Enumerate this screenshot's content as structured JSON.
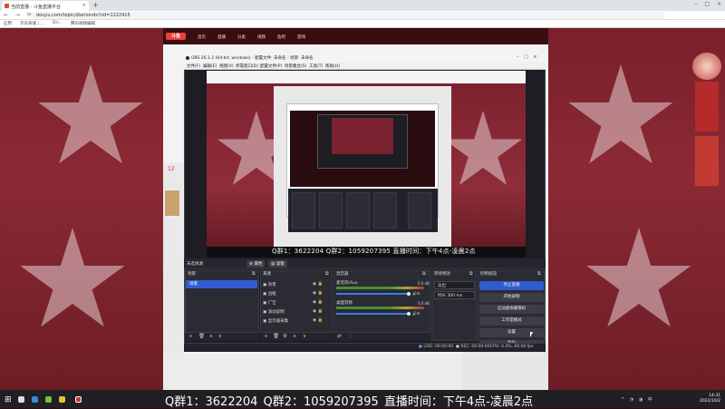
{
  "browser": {
    "tab_title": "当前直播 - 斗鱼直播平台",
    "new_tab": "+",
    "window_controls": [
      "–",
      "□",
      "×"
    ],
    "nav_icons": [
      "←",
      "→",
      "⟳"
    ],
    "url": "douyu.com/topic/diamonds?rid=1222415",
    "bookmarks": [
      "应用",
      "京东商城 | ...",
      "Dri...",
      "腾讯视频编辑"
    ]
  },
  "site": {
    "logo": "斗鱼",
    "nav": [
      "首页",
      "直播",
      "分类",
      "视频",
      "鱼吧",
      "游戏"
    ],
    "side_count": "12"
  },
  "obs": {
    "title": "OBS 26.1.2 (64-bit, windows) - 配置文件: 未命名 - 场景: 未命名",
    "window_controls": "– □ ×",
    "menu": [
      "文件(F)",
      "编辑(E)",
      "视图(V)",
      "停靠窗口(D)",
      "配置文件(P)",
      "场景集合(S)",
      "工具(T)",
      "帮助(H)"
    ],
    "preview_overlay": "Q群1：3622204    Q群2：1059207395    直播时间：下午4点-凌晨2点",
    "scene_bar": {
      "label": "未选择源",
      "tab1": "属性",
      "tab2": "滤镜"
    },
    "docks": {
      "scenes": {
        "title": "场景",
        "selected": "场景"
      },
      "sources": {
        "title": "来源",
        "items": [
          "背景",
          "边框",
          "广告",
          "滚动说明",
          "显示器采集"
        ]
      },
      "mixer": {
        "title": "混音器",
        "channels": [
          {
            "name": "麦克风/Aux",
            "db": "0.0 dB"
          },
          {
            "name": "桌面音频",
            "db": "0.0 dB"
          }
        ]
      },
      "transitions": {
        "title": "转场特效",
        "type": "淡出",
        "duration_label": "时长",
        "duration": "300 ms"
      },
      "controls": {
        "title": "控制按钮",
        "buttons": [
          "停止直播",
          "开始录制",
          "启动虚拟摄像机",
          "工作室模式",
          "设置",
          "退出"
        ]
      }
    },
    "status": {
      "dropped": "0",
      "live": "LIVE: 00:00:00",
      "rec": "REC: 00:00:00",
      "cpu": "CPU: 0.4%, 60.00 fps"
    }
  },
  "banner": {
    "text": "Q群1：3622204    Q群2：1059207395    直播时间：下午4点-凌晨2点"
  },
  "taskbar": {
    "start": "⊞",
    "time": "14:31",
    "date": "2022/10/2"
  },
  "colors": {
    "accent": "#2f5ccf",
    "obs_bg": "#1d1d23",
    "brand": "#e8423a"
  }
}
